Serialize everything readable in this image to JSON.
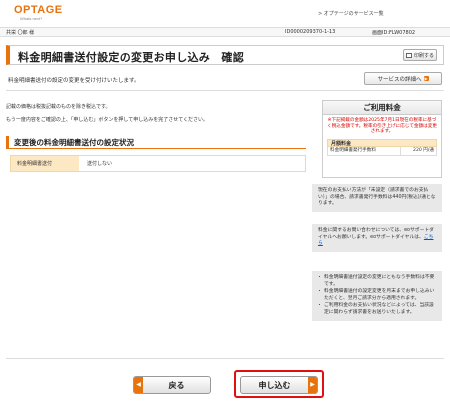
{
  "header": {
    "logo_text": "OPTAGE",
    "logo_tagline": "Whats next?",
    "services_link": "> オプテージのサービス一覧"
  },
  "info_bar": {
    "user": "共栄 〇郎 様",
    "customer_id": "ID0000209370-1-13",
    "screen_id": "画面ID:FLW07802"
  },
  "page": {
    "title": "料金明細書送付設定の変更お申し込み　確認",
    "print_label": "印刷する",
    "accepted_text": "料金明細書送付の設定の変更を受け付けいたします。",
    "service_detail_label": "サービスの詳細へ"
  },
  "notes": [
    "記載の価格は税抜記載のものを除き税込です。",
    "もう一度内容をご確認の上、「申し込む」ボタンを押して申し込みを完了させてください。"
  ],
  "section": {
    "title": "変更後の料金明細書送付の設定状況",
    "row_label": "料金明細書送付",
    "row_value": "送付しない"
  },
  "fee_box": {
    "title": "ご利用料金",
    "notice": "※下記掲載の金額は2025年7月1日現在の税率に基づく税込金額です。税率の引き上げに応じて金額は変更されます。",
    "monthly_label": "月額料金",
    "item_label": "料金明細書発行手数料",
    "item_amount": "220 円/通"
  },
  "side_boxes": {
    "box1": "現在のお支払い方法が「未設定（請求書でのお支払い）」の場合、請求書発行手数料は440円(税込)/通となります。",
    "box2_text": "料金に関するお問い合わせについては、eoサポートダイヤルへお願いします。eoサポートダイヤルは、",
    "box2_link": "こちら",
    "box3": [
      "料金明細書送付設定の変更にともなう手数料は不要です。",
      "料金明細書送付の設定変更を月末までお申し込みいただくと、翌月ご請求分から適用されます。",
      "ご利用料金のお支払い状況などによっては、当該設定に関わらず請求書をお送りいたします。"
    ]
  },
  "buttons": {
    "back": "戻る",
    "submit": "申し込む"
  },
  "colors": {
    "accent": "#e8720c",
    "highlight": "#e01010"
  }
}
